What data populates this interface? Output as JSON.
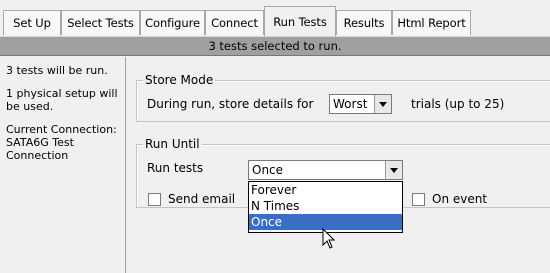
{
  "tabs": [
    {
      "label": "Set Up",
      "active": false
    },
    {
      "label": "Select Tests",
      "active": false
    },
    {
      "label": "Configure",
      "active": false
    },
    {
      "label": "Connect",
      "active": false
    },
    {
      "label": "Run Tests",
      "active": true
    },
    {
      "label": "Results",
      "active": false
    },
    {
      "label": "Html Report",
      "active": false
    }
  ],
  "status": "3 tests selected to run.",
  "side_panel": {
    "tests_text": "3 tests will be run.",
    "setup_text": "1 physical setup will be used.",
    "connection_text": "Current Connection: SATA6G Test Connection"
  },
  "store_mode": {
    "legend": "Store Mode",
    "prefix": "During run, store details for",
    "selected": "Worst",
    "suffix": "trials (up to 25)"
  },
  "run_until": {
    "legend": "Run Until",
    "run_tests_label": "Run tests",
    "selected": "Once",
    "options": [
      "Forever",
      "N Times",
      "Once"
    ],
    "highlighted_option": "Once",
    "send_email_label": "Send email",
    "on_event_label": "On event"
  },
  "colors": {
    "status_bar": "#a0a0a0",
    "selection": "#3a6ec4"
  },
  "icons": {
    "cursor": "arrow-pointer",
    "dropdown": "chevron-down"
  }
}
